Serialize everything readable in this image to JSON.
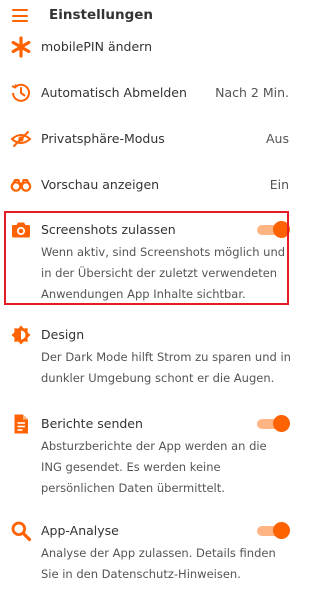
{
  "header": {
    "title": "Einstellungen"
  },
  "rows": [
    {
      "label": "mobilePIN ändern"
    },
    {
      "label": "Automatisch Abmelden",
      "value": "Nach 2 Min."
    },
    {
      "label": "Privatsphäre-Modus",
      "value": "Aus"
    },
    {
      "label": "Vorschau anzeigen",
      "value": "Ein"
    },
    {
      "label": "Screenshots zulassen",
      "toggle": "on",
      "desc": "Wenn aktiv, sind Screenshots möglich und in der Übersicht der zuletzt verwendeten Anwendungen App Inhalte sichtbar."
    },
    {
      "label": "Design",
      "desc": "Der Dark Mode hilft Strom zu sparen und in dunkler Umgebung schont er die Augen."
    },
    {
      "label": "Berichte senden",
      "toggle": "on",
      "desc": "Absturzberichte der App werden an die ING gesendet. Es werden keine persönlichen Daten übermittelt."
    },
    {
      "label": "App-Analyse",
      "toggle": "on",
      "desc": "Analyse der App zulassen. Details finden Sie in den Datenschutz-Hinweisen."
    }
  ],
  "icons": {
    "menu": "menu-icon",
    "row0": "asterisk-icon",
    "row1": "timer-icon",
    "row2": "eye-off-icon",
    "row3": "binoculars-icon",
    "row4": "camera-icon",
    "row5": "contrast-icon",
    "row6": "document-icon",
    "row7": "search-icon"
  },
  "colors": {
    "accent": "#ff6200",
    "toggle_track": "#ffb484",
    "highlight": "#e51c23"
  }
}
